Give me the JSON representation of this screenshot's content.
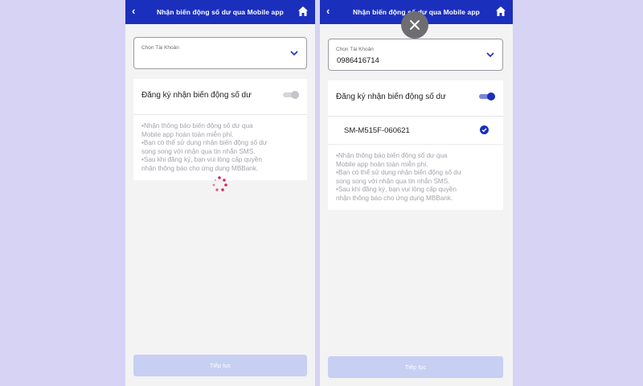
{
  "colors": {
    "primary": "#1b2fbd",
    "background": "#d6d3f4",
    "disabled_button": "#c7cff2"
  },
  "left": {
    "header": {
      "title": "Nhận biến động số dư qua Mobile app",
      "back_icon": "chevron-left-icon",
      "home_icon": "home-icon"
    },
    "account": {
      "label": "Chọn Tài Khoản",
      "value": ""
    },
    "toggle": {
      "label": "Đăng ký nhận biến động số dư",
      "state": "off"
    },
    "info": [
      "•Nhận thông báo biến động số dư qua",
      "Mobile app hoàn toàn miễn phí.",
      "•Bạn có thể sử dụng nhận biến động số dư",
      "song song với nhận qua tin nhắn SMS.",
      "•Sau khi đăng ký, bạn vui lòng cấp quyền",
      "nhận thông báo cho ứng dụng MBBank."
    ],
    "continue_label": "Tiếp tục",
    "loading_icon": "loading-spinner-icon"
  },
  "right": {
    "header": {
      "title": "Nhận biến động số dư qua Mobile app",
      "back_icon": "chevron-left-icon",
      "home_icon": "home-icon"
    },
    "account": {
      "label": "Chọn Tài Khoản",
      "value": "0986416714"
    },
    "toggle": {
      "label": "Đăng ký nhận biến động số dư",
      "state": "on"
    },
    "device": {
      "name": "SM-M515F-060621",
      "selected": true
    },
    "info": [
      "•Nhận thông báo biến động số dư qua",
      "Mobile app hoàn toàn miễn phí.",
      "•Bạn có thể sử dụng nhận biến động số dư",
      "song song với nhận qua tin nhắn SMS.",
      "•Sau khi đăng ký, bạn vui lòng cấp quyền",
      "nhận thông báo cho ứng dụng MBBank."
    ],
    "continue_label": "Tiếp tục",
    "close_icon": "close-icon"
  }
}
